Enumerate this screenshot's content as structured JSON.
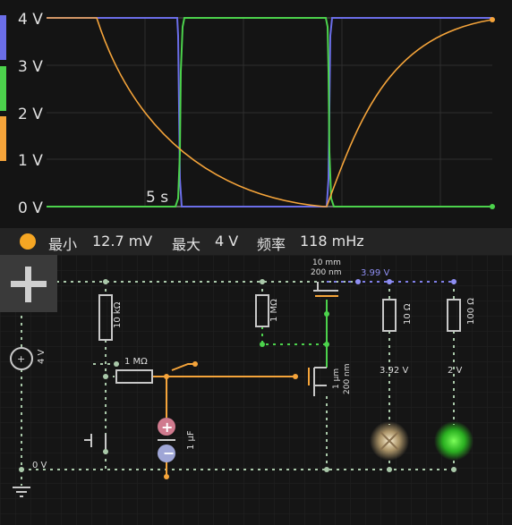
{
  "scope": {
    "y_tick_labels": [
      "4 V",
      "3 V",
      "2 V",
      "1 V",
      "0 V"
    ],
    "time_label": "5 s",
    "colors": {
      "blue": "#6b6ee8",
      "green": "#4cd24c",
      "orange": "#f5a43a"
    }
  },
  "status": {
    "dot_color": "#f5a623",
    "min_label": "最小",
    "min_value": "12.7 mV",
    "max_label": "最大",
    "max_value": "4 V",
    "freq_label": "频率",
    "freq_value": "118 mHz"
  },
  "circuit": {
    "source_label": "4 V",
    "ground_label": "0 V",
    "r_pullup": "10 kΩ",
    "r_series": "1 MΩ",
    "r_gate": "1 MΩ",
    "cap": "1 μF",
    "pmos_len": "10 mm",
    "pmos_width": "200 nm",
    "nmos_len": "1 μm",
    "nmos_width": "200 nm",
    "v_top": "3.99 V",
    "r_lamp": "10 Ω",
    "r_led": "100 Ω",
    "v_lamp": "3.92 V",
    "v_led": "2 V"
  },
  "toolbar": {
    "add_label": "+"
  }
}
